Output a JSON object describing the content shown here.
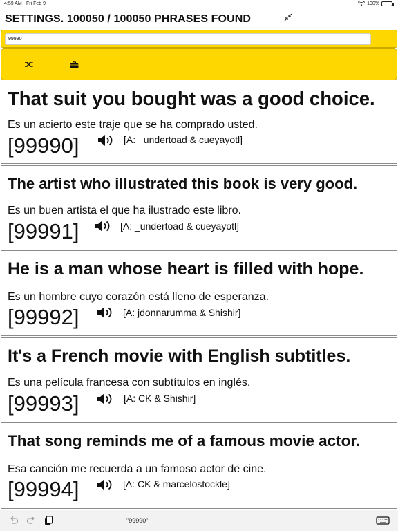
{
  "status": {
    "time": "4:59 AM",
    "date": "Fri Feb 9",
    "battery": "100%",
    "battery_level": 1.0
  },
  "header": {
    "title": "SETTINGS. 100050 / 100050 PHRASES FOUND"
  },
  "search": {
    "value": "99990",
    "placeholder": ""
  },
  "colors": {
    "accent": "#ffd700",
    "card_border": "#8a8a8a",
    "text": "#111111"
  },
  "icons": {
    "collapse": "collapse-arrows-icon",
    "shuffle": "shuffle-icon",
    "briefcase": "briefcase-icon",
    "speaker": "speaker-icon",
    "undo": "undo-icon",
    "redo": "redo-icon",
    "paste": "paste-icon",
    "keyboard": "keyboard-icon"
  },
  "phrases": [
    {
      "english": "That suit you bought was a good choice.",
      "spanish": "Es un acierto este traje que se ha comprado usted.",
      "number": "[99990]",
      "attribution": "[A: _undertoad & cueyayotl]"
    },
    {
      "english": "The artist who illustrated this book is very good.",
      "spanish": "Es un buen artista el que ha ilustrado este libro.",
      "number": "[99991]",
      "attribution": "[A: _undertoad & cueyayotl]"
    },
    {
      "english": "He is a man whose heart is filled with hope.",
      "spanish": "Es un hombre cuyo corazón está lleno de esperanza.",
      "number": "[99992]",
      "attribution": "[A: jdonnarumma & Shishir]"
    },
    {
      "english": "It's a French movie with English subtitles.",
      "spanish": "Es una película francesa con subtítulos en inglés.",
      "number": "[99993]",
      "attribution": "[A: CK & Shishir]"
    },
    {
      "english": "That song reminds me of a famous movie actor.",
      "spanish": "Esa canción me recuerda a un famoso actor de cine.",
      "number": "[99994]",
      "attribution": "[A: CK & marcelostockle]"
    }
  ],
  "bottom": {
    "suggestion": "\"99990\""
  }
}
